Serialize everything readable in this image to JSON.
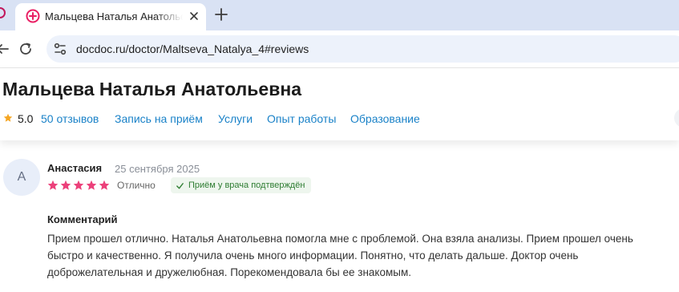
{
  "browser": {
    "tab_title": "Мальцева Наталья Анатольевна",
    "url": "docdoc.ru/doctor/Maltseva_Natalya_4#reviews",
    "icons": {
      "favicon": "docdoc-plus-icon",
      "close": "close-icon",
      "new_tab": "plus-icon",
      "back": "arrow-left-icon",
      "reload": "reload-icon",
      "site_info": "tune-icon"
    },
    "colors": {
      "tabstrip": "#d9e2f4",
      "omnibox": "#edf2fb",
      "favicon": "#e91e63"
    }
  },
  "doctor": {
    "name": "Мальцева Наталья Анатольевна",
    "rating": "5.0",
    "rating_icon": "star-icon"
  },
  "nav": {
    "reviews": "50 отзывов",
    "appointment": "Запись на приём",
    "services": "Услуги",
    "experience": "Опыт работы",
    "education": "Образование"
  },
  "review": {
    "avatar_letter": "А",
    "author": "Анастасия",
    "date": "25 сентября 2025",
    "stars": 5,
    "rating_label": "Отлично",
    "verified": "Приём у врача подтверждён",
    "comment_label": "Комментарий",
    "comment": "Прием прошел отлично. Наталья Анатольевна помогла мне с проблемой. Она взяла анализы. Прием прошел очень быстро и качественно. Я получила очень много информации. Понятно, что делать дальше. Доктор очень доброжелательная и дружелюбная. Порекомендовала бы ее знакомым."
  },
  "colors": {
    "accent_link": "#1a82c8",
    "star_rating": "#f5a623",
    "review_star": "#ec407a",
    "verified_text": "#2e7d32",
    "verified_bg": "#eef6ee"
  }
}
